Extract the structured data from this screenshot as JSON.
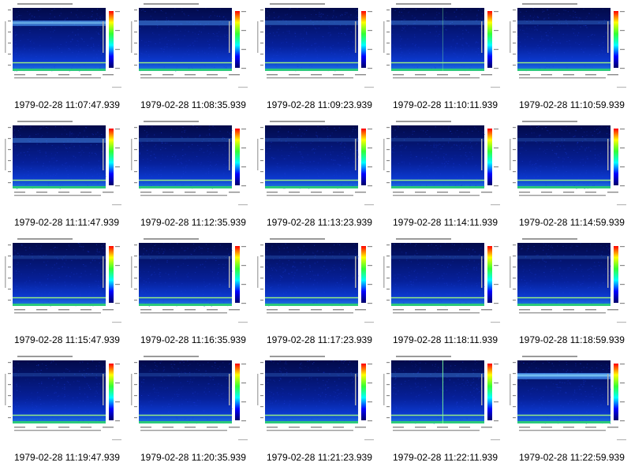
{
  "panels": [
    {
      "timestamp": "1979-02-28 11:07:47.939",
      "band": 0.75,
      "spike": 0
    },
    {
      "timestamp": "1979-02-28 11:08:35.939",
      "band": 0.55,
      "spike": 0
    },
    {
      "timestamp": "1979-02-28 11:09:23.939",
      "band": 0.45,
      "spike": 0
    },
    {
      "timestamp": "1979-02-28 11:10:11.939",
      "band": 0.4,
      "spike": 0.4
    },
    {
      "timestamp": "1979-02-28 11:10:59.939",
      "band": 0.25,
      "spike": 0
    },
    {
      "timestamp": "1979-02-28 11:11:47.939",
      "band": 0.5,
      "spike": 0
    },
    {
      "timestamp": "1979-02-28 11:12:35.939",
      "band": 0.2,
      "spike": 0
    },
    {
      "timestamp": "1979-02-28 11:13:23.939",
      "band": 0.15,
      "spike": 0
    },
    {
      "timestamp": "1979-02-28 11:14:11.939",
      "band": 0.1,
      "spike": 0
    },
    {
      "timestamp": "1979-02-28 11:14:59.939",
      "band": 0.1,
      "spike": 0
    },
    {
      "timestamp": "1979-02-28 11:15:47.939",
      "band": 0.1,
      "spike": 0
    },
    {
      "timestamp": "1979-02-28 11:16:35.939",
      "band": 0.1,
      "spike": 0
    },
    {
      "timestamp": "1979-02-28 11:17:23.939",
      "band": 0.1,
      "spike": 0
    },
    {
      "timestamp": "1979-02-28 11:18:11.939",
      "band": 0.1,
      "spike": 0
    },
    {
      "timestamp": "1979-02-28 11:18:59.939",
      "band": 0.1,
      "spike": 0
    },
    {
      "timestamp": "1979-02-28 11:19:47.939",
      "band": 0.1,
      "spike": 0
    },
    {
      "timestamp": "1979-02-28 11:20:35.939",
      "band": 0.1,
      "spike": 0
    },
    {
      "timestamp": "1979-02-28 11:21:23.939",
      "band": 0.15,
      "spike": 0
    },
    {
      "timestamp": "1979-02-28 11:22:11.939",
      "band": 0.35,
      "spike": 0.9
    },
    {
      "timestamp": "1979-02-28 11:22:59.939",
      "band": 0.95,
      "spike": 0
    }
  ],
  "colors": {
    "background_dark": "#000a5a",
    "noise": "#1a3cd8",
    "band": "#4fa0ff",
    "bright_band": "#8fe0ff",
    "low_freq_line": "#a6ff7a",
    "low_freq_base": "#2fd86a",
    "axis_text": "#444444"
  }
}
